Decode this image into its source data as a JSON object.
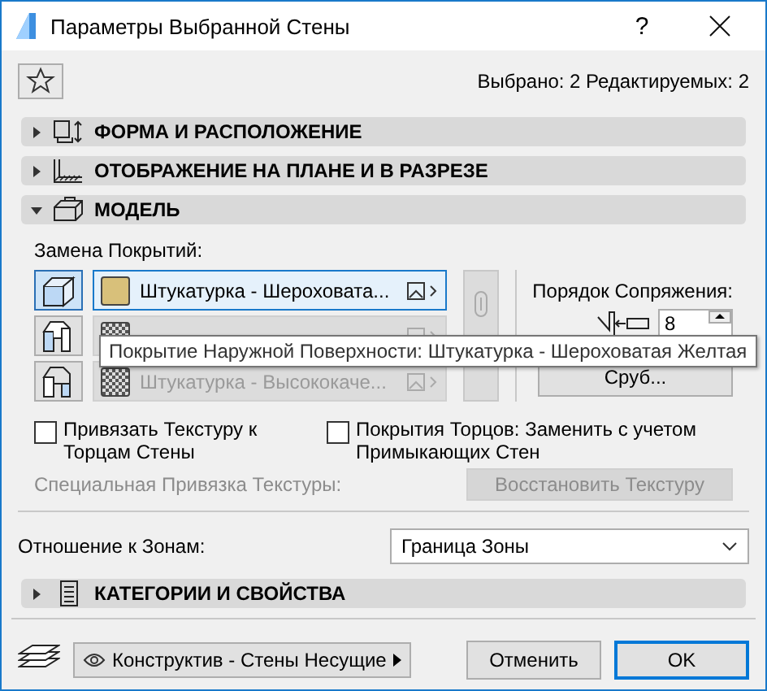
{
  "window": {
    "title": "Параметры Выбранной Стены",
    "help": "?"
  },
  "selection_info": "Выбрано: 2 Редактируемых: 2",
  "sections_top": [
    {
      "title": "ФОРМА И РАСПОЛОЖЕНИЕ",
      "expanded": false,
      "kind": "shape"
    },
    {
      "title": "ОТОБРАЖЕНИЕ НА ПЛАНЕ И В РАЗРЕЗЕ",
      "expanded": false,
      "kind": "hatch"
    },
    {
      "title": "МОДЕЛЬ",
      "expanded": true,
      "kind": "box"
    }
  ],
  "surfaces": {
    "label": "Замена Покрытий:",
    "rows": [
      {
        "kind": "outer",
        "selected": true,
        "disabled": false,
        "text": "Штукатурка - Шероховата...",
        "textured": false,
        "color": "#d8c07a"
      },
      {
        "kind": "edge",
        "selected": false,
        "disabled": true,
        "text": "",
        "textured": true
      },
      {
        "kind": "inner",
        "selected": false,
        "disabled": true,
        "text": "Штукатурка - Высококаче...",
        "textured": true
      }
    ],
    "tooltip": "Покрытие Наружной Поверхности: Штукатурка - Шероховатая Желтая"
  },
  "priority": {
    "label": "Порядок Сопряжения:",
    "value": "8",
    "button": "Сруб..."
  },
  "checkboxes": [
    {
      "label": "Привязать Текстуру к Торцам Стены",
      "checked": false
    },
    {
      "label": "Покрытия Торцов: Заменить с учетом Примыкающих Стен",
      "checked": false
    }
  ],
  "texture": {
    "label": "Специальная Привязка Текстуры:",
    "button": "Восстановить Текстуру",
    "disabled": true
  },
  "zones": {
    "label": "Отношение к Зонам:",
    "value": "Граница Зоны"
  },
  "sections_bottom": [
    {
      "title": "КАТЕГОРИИ И СВОЙСТВА",
      "expanded": false,
      "kind": "list"
    }
  ],
  "footer": {
    "layer": "Конструктив - Стены Несущие",
    "cancel": "Отменить",
    "ok": "OK"
  }
}
